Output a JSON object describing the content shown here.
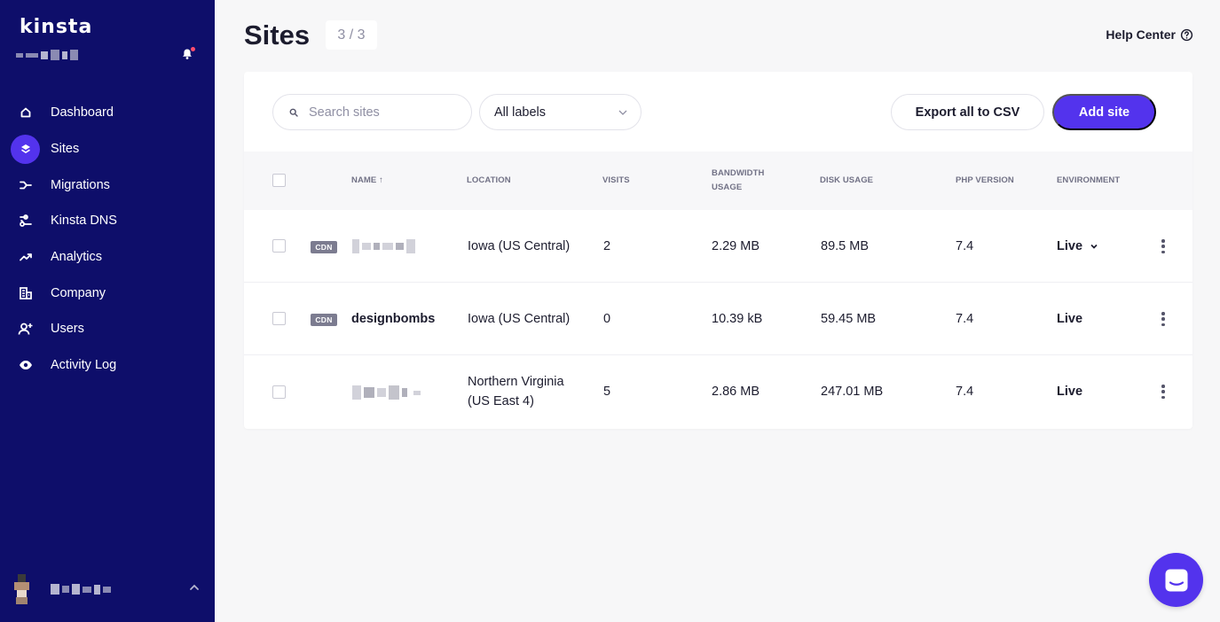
{
  "brand": {
    "logo": "kinsta",
    "accent": "#5333ed",
    "sidebar_bg": "#0e0e6a"
  },
  "sidebar": {
    "items": [
      {
        "label": "Dashboard",
        "icon": "home-icon"
      },
      {
        "label": "Sites",
        "icon": "layers-icon",
        "active": true
      },
      {
        "label": "Migrations",
        "icon": "migrate-icon"
      },
      {
        "label": "Kinsta DNS",
        "icon": "dns-icon"
      },
      {
        "label": "Analytics",
        "icon": "trend-icon"
      },
      {
        "label": "Company",
        "icon": "building-icon"
      },
      {
        "label": "Users",
        "icon": "add-user-icon"
      },
      {
        "label": "Activity Log",
        "icon": "eye-icon"
      }
    ]
  },
  "header": {
    "title": "Sites",
    "count": "3 / 3",
    "help": "Help Center"
  },
  "toolbar": {
    "search_placeholder": "Search sites",
    "labels_value": "All labels",
    "export_label": "Export all to CSV",
    "add_label": "Add site"
  },
  "table": {
    "columns": {
      "name": "NAME ↑",
      "location": "LOCATION",
      "visits": "VISITS",
      "bandwidth_1": "BANDWIDTH",
      "bandwidth_2": "USAGE",
      "disk": "DISK USAGE",
      "php": "PHP VERSION",
      "env": "ENVIRONMENT"
    },
    "rows": [
      {
        "cdn": "CDN",
        "name": "",
        "location_1": "Iowa (US Central)",
        "location_2": "",
        "visits": "2",
        "bandwidth": "2.29 MB",
        "disk": "89.5 MB",
        "php": "7.4",
        "env": "Live"
      },
      {
        "cdn": "CDN",
        "name": "designbombs",
        "location_1": "Iowa (US Central)",
        "location_2": "",
        "visits": "0",
        "bandwidth": "10.39 kB",
        "disk": "59.45 MB",
        "php": "7.4",
        "env": "Live"
      },
      {
        "cdn": "",
        "name": "",
        "location_1": "Northern Virginia",
        "location_2": "(US East 4)",
        "visits": "5",
        "bandwidth": "2.86 MB",
        "disk": "247.01 MB",
        "php": "7.4",
        "env": "Live"
      }
    ]
  }
}
